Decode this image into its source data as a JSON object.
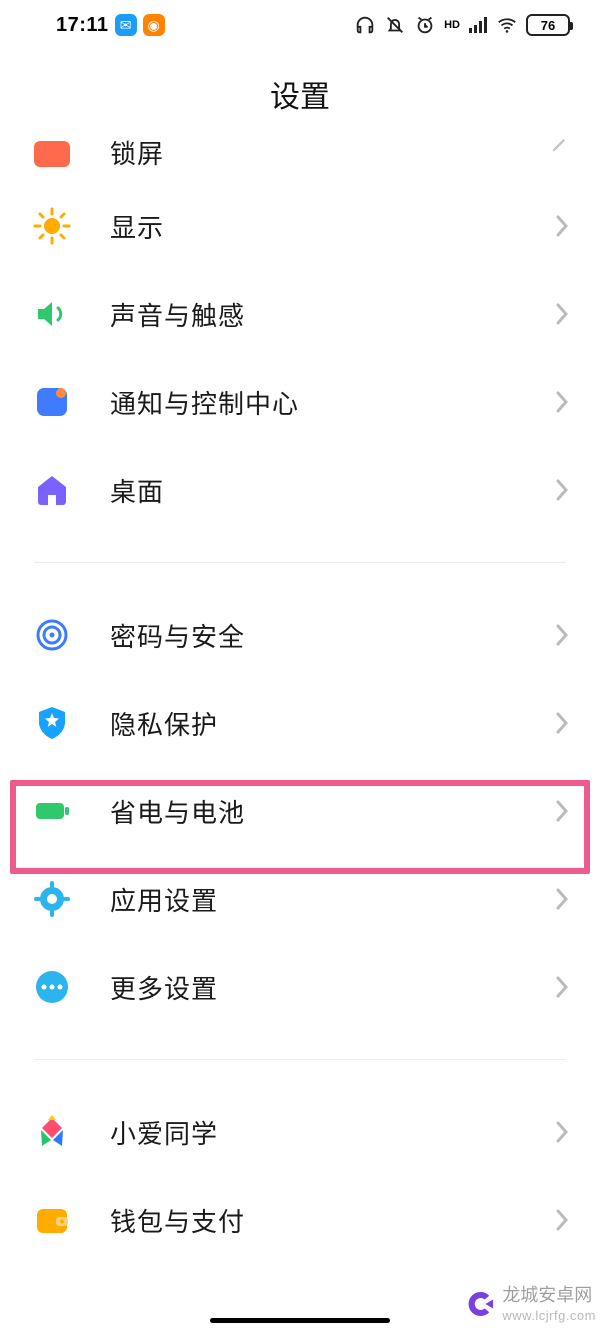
{
  "status": {
    "time": "17:11",
    "battery": "76",
    "hd_label": "HD"
  },
  "header": {
    "title": "设置"
  },
  "items": {
    "lock": {
      "label": "锁屏"
    },
    "display": {
      "label": "显示"
    },
    "sound": {
      "label": "声音与触感"
    },
    "notif": {
      "label": "通知与控制中心"
    },
    "home": {
      "label": "桌面"
    },
    "security": {
      "label": "密码与安全"
    },
    "privacy": {
      "label": "隐私保护"
    },
    "battery": {
      "label": "省电与电池"
    },
    "apps": {
      "label": "应用设置"
    },
    "more": {
      "label": "更多设置"
    },
    "xiaoai": {
      "label": "小爱同学"
    },
    "wallet": {
      "label": "钱包与支付"
    }
  },
  "watermark": {
    "name": "龙城安卓网",
    "url": "www.lcjrfg.com"
  }
}
